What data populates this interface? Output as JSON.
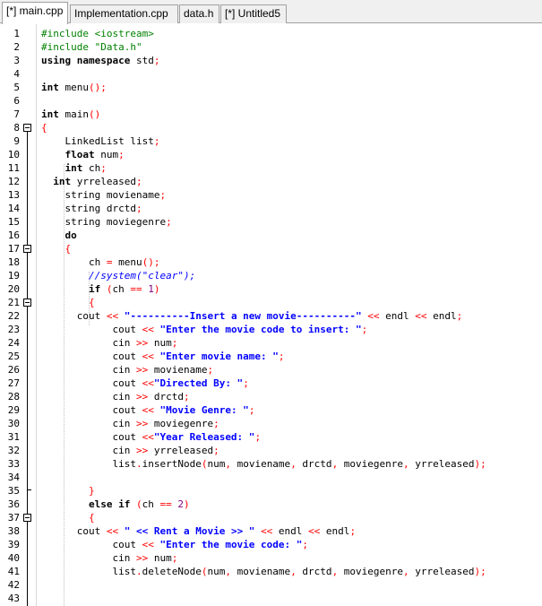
{
  "tabs": [
    {
      "label": "[*] main.cpp",
      "active": true
    },
    {
      "label": "Implementation.cpp",
      "active": false
    },
    {
      "label": "data.h",
      "active": false
    },
    {
      "label": "[*] Untitled5",
      "active": false
    }
  ],
  "lines": [
    {
      "n": "1",
      "t": [
        [
          "pp",
          "#include <iostream>"
        ]
      ]
    },
    {
      "n": "2",
      "t": [
        [
          "pp",
          "#include \"Data.h\""
        ]
      ]
    },
    {
      "n": "3",
      "t": [
        [
          "kw",
          "using namespace"
        ],
        [
          "",
          " std"
        ],
        [
          "op",
          ";"
        ]
      ]
    },
    {
      "n": "4",
      "t": []
    },
    {
      "n": "5",
      "t": [
        [
          "kw",
          "int"
        ],
        [
          "",
          " menu"
        ],
        [
          "op",
          "();"
        ]
      ]
    },
    {
      "n": "6",
      "t": []
    },
    {
      "n": "7",
      "t": [
        [
          "kw",
          "int"
        ],
        [
          "",
          " main"
        ],
        [
          "op",
          "()"
        ]
      ]
    },
    {
      "n": "8",
      "t": [
        [
          "op",
          "{"
        ]
      ]
    },
    {
      "n": "9",
      "t": [
        [
          "",
          "    LinkedList list"
        ],
        [
          "op",
          ";"
        ]
      ]
    },
    {
      "n": "10",
      "t": [
        [
          "kw",
          "    float"
        ],
        [
          "",
          " num"
        ],
        [
          "op",
          ";"
        ]
      ]
    },
    {
      "n": "11",
      "t": [
        [
          "kw",
          "    int"
        ],
        [
          "",
          " ch"
        ],
        [
          "op",
          ";"
        ]
      ]
    },
    {
      "n": "12",
      "t": [
        [
          "kw",
          "  int"
        ],
        [
          "",
          " yrreleased"
        ],
        [
          "op",
          ";"
        ]
      ]
    },
    {
      "n": "13",
      "t": [
        [
          "",
          "    string moviename"
        ],
        [
          "op",
          ";"
        ]
      ]
    },
    {
      "n": "14",
      "t": [
        [
          "",
          "    string drctd"
        ],
        [
          "op",
          ";"
        ]
      ]
    },
    {
      "n": "15",
      "t": [
        [
          "",
          "    string moviegenre"
        ],
        [
          "op",
          ";"
        ]
      ]
    },
    {
      "n": "16",
      "t": [
        [
          "kw",
          "    do"
        ]
      ]
    },
    {
      "n": "17",
      "t": [
        [
          "",
          "    "
        ],
        [
          "op",
          "{"
        ]
      ]
    },
    {
      "n": "18",
      "t": [
        [
          "",
          "        ch "
        ],
        [
          "op",
          "="
        ],
        [
          "",
          " menu"
        ],
        [
          "op",
          "();"
        ]
      ]
    },
    {
      "n": "19",
      "t": [
        [
          "cm",
          "        //system(\"clear\");"
        ]
      ]
    },
    {
      "n": "20",
      "t": [
        [
          "kw",
          "        if"
        ],
        [
          "",
          " "
        ],
        [
          "op",
          "("
        ],
        [
          "",
          "ch "
        ],
        [
          "op",
          "=="
        ],
        [
          "",
          " "
        ],
        [
          "num",
          "1"
        ],
        [
          "op",
          ")"
        ]
      ]
    },
    {
      "n": "21",
      "t": [
        [
          "",
          "        "
        ],
        [
          "op",
          "{"
        ]
      ]
    },
    {
      "n": "22",
      "t": [
        [
          "",
          "      cout "
        ],
        [
          "op",
          "<<"
        ],
        [
          "",
          " "
        ],
        [
          "str",
          "\"----------Insert a new movie----------\""
        ],
        [
          "",
          " "
        ],
        [
          "op",
          "<<"
        ],
        [
          "",
          " endl "
        ],
        [
          "op",
          "<<"
        ],
        [
          "",
          " endl"
        ],
        [
          "op",
          ";"
        ]
      ]
    },
    {
      "n": "23",
      "t": [
        [
          "",
          "            cout "
        ],
        [
          "op",
          "<<"
        ],
        [
          "",
          " "
        ],
        [
          "str",
          "\"Enter the movie code to insert: \""
        ],
        [
          "op",
          ";"
        ]
      ]
    },
    {
      "n": "24",
      "t": [
        [
          "",
          "            cin "
        ],
        [
          "op",
          ">>"
        ],
        [
          "",
          " num"
        ],
        [
          "op",
          ";"
        ]
      ]
    },
    {
      "n": "25",
      "t": [
        [
          "",
          "            cout "
        ],
        [
          "op",
          "<<"
        ],
        [
          "",
          " "
        ],
        [
          "str",
          "\"Enter movie name: \""
        ],
        [
          "op",
          ";"
        ]
      ]
    },
    {
      "n": "26",
      "t": [
        [
          "",
          "            cin "
        ],
        [
          "op",
          ">>"
        ],
        [
          "",
          " moviename"
        ],
        [
          "op",
          ";"
        ]
      ]
    },
    {
      "n": "27",
      "t": [
        [
          "",
          "            cout "
        ],
        [
          "op",
          "<<"
        ],
        [
          "str",
          "\"Directed By: \""
        ],
        [
          "op",
          ";"
        ]
      ]
    },
    {
      "n": "28",
      "t": [
        [
          "",
          "            cin "
        ],
        [
          "op",
          ">>"
        ],
        [
          "",
          " drctd"
        ],
        [
          "op",
          ";"
        ]
      ]
    },
    {
      "n": "29",
      "t": [
        [
          "",
          "            cout "
        ],
        [
          "op",
          "<<"
        ],
        [
          "",
          " "
        ],
        [
          "str",
          "\"Movie Genre: \""
        ],
        [
          "op",
          ";"
        ]
      ]
    },
    {
      "n": "30",
      "t": [
        [
          "",
          "            cin "
        ],
        [
          "op",
          ">>"
        ],
        [
          "",
          " moviegenre"
        ],
        [
          "op",
          ";"
        ]
      ]
    },
    {
      "n": "31",
      "t": [
        [
          "",
          "            cout "
        ],
        [
          "op",
          "<<"
        ],
        [
          "str",
          "\"Year Released: \""
        ],
        [
          "op",
          ";"
        ]
      ]
    },
    {
      "n": "32",
      "t": [
        [
          "",
          "            cin "
        ],
        [
          "op",
          ">>"
        ],
        [
          "",
          " yrreleased"
        ],
        [
          "op",
          ";"
        ]
      ]
    },
    {
      "n": "33",
      "t": [
        [
          "",
          "            list"
        ],
        [
          "op",
          "."
        ],
        [
          "",
          "insertNode"
        ],
        [
          "op",
          "("
        ],
        [
          "",
          "num"
        ],
        [
          "op",
          ","
        ],
        [
          "",
          " moviename"
        ],
        [
          "op",
          ","
        ],
        [
          "",
          " drctd"
        ],
        [
          "op",
          ","
        ],
        [
          "",
          " moviegenre"
        ],
        [
          "op",
          ","
        ],
        [
          "",
          " yrreleased"
        ],
        [
          "op",
          ");"
        ]
      ]
    },
    {
      "n": "34",
      "t": []
    },
    {
      "n": "35",
      "t": [
        [
          "",
          "        "
        ],
        [
          "op",
          "}"
        ]
      ]
    },
    {
      "n": "36",
      "t": [
        [
          "kw",
          "        else if"
        ],
        [
          "",
          " "
        ],
        [
          "op",
          "("
        ],
        [
          "",
          "ch "
        ],
        [
          "op",
          "=="
        ],
        [
          "",
          " "
        ],
        [
          "num",
          "2"
        ],
        [
          "op",
          ")"
        ]
      ]
    },
    {
      "n": "37",
      "t": [
        [
          "",
          "        "
        ],
        [
          "op",
          "{"
        ]
      ]
    },
    {
      "n": "38",
      "t": [
        [
          "",
          "      cout "
        ],
        [
          "op",
          "<<"
        ],
        [
          "",
          " "
        ],
        [
          "str",
          "\" << Rent a Movie >> \""
        ],
        [
          "",
          " "
        ],
        [
          "op",
          "<<"
        ],
        [
          "",
          " endl "
        ],
        [
          "op",
          "<<"
        ],
        [
          "",
          " endl"
        ],
        [
          "op",
          ";"
        ]
      ]
    },
    {
      "n": "39",
      "t": [
        [
          "",
          "            cout "
        ],
        [
          "op",
          "<<"
        ],
        [
          "",
          " "
        ],
        [
          "str",
          "\"Enter the movie code: \""
        ],
        [
          "op",
          ";"
        ]
      ]
    },
    {
      "n": "40",
      "t": [
        [
          "",
          "            cin "
        ],
        [
          "op",
          ">>"
        ],
        [
          "",
          " num"
        ],
        [
          "op",
          ";"
        ]
      ]
    },
    {
      "n": "41",
      "t": [
        [
          "",
          "            list"
        ],
        [
          "op",
          "."
        ],
        [
          "",
          "deleteNode"
        ],
        [
          "op",
          "("
        ],
        [
          "",
          "num"
        ],
        [
          "op",
          ","
        ],
        [
          "",
          " moviename"
        ],
        [
          "op",
          ","
        ],
        [
          "",
          " drctd"
        ],
        [
          "op",
          ","
        ],
        [
          "",
          " moviegenre"
        ],
        [
          "op",
          ","
        ],
        [
          "",
          " yrreleased"
        ],
        [
          "op",
          ");"
        ]
      ]
    },
    {
      "n": "42",
      "t": []
    },
    {
      "n": "43",
      "t": []
    }
  ]
}
